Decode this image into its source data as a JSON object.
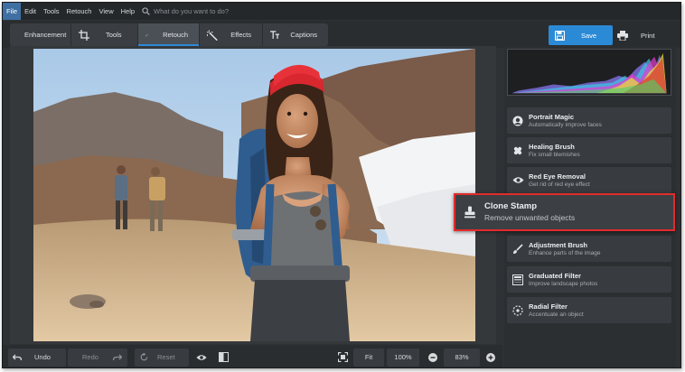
{
  "menu": {
    "items": [
      "File",
      "Edit",
      "Tools",
      "Retouch",
      "View",
      "Help"
    ],
    "search_placeholder": "What do you want to do?"
  },
  "tabs": [
    {
      "label": "Enhancement",
      "icon": "sliders-icon"
    },
    {
      "label": "Tools",
      "icon": "crop-icon"
    },
    {
      "label": "Retouch",
      "icon": "brush-icon",
      "active": true
    },
    {
      "label": "Effects",
      "icon": "magic-wand-icon"
    },
    {
      "label": "Captions",
      "icon": "text-icon"
    }
  ],
  "actions": {
    "save": "Save",
    "print": "Print"
  },
  "tools": [
    {
      "title": "Portrait Magic",
      "subtitle": "Automatically improve faces",
      "icon": "portrait-icon"
    },
    {
      "title": "Healing Brush",
      "subtitle": "Fix small blemishes",
      "icon": "bandage-icon"
    },
    {
      "title": "Red Eye Removal",
      "subtitle": "Get rid of red eye effect",
      "icon": "eye-icon"
    },
    {
      "title": "Clone Stamp",
      "subtitle": "Remove unwanted objects",
      "icon": "stamp-icon",
      "highlighted": true
    },
    {
      "title": "Adjustment Brush",
      "subtitle": "Enhance parts of the image",
      "icon": "brush-icon"
    },
    {
      "title": "Graduated Filter",
      "subtitle": "Improve landscape photos",
      "icon": "gradient-icon"
    },
    {
      "title": "Radial Filter",
      "subtitle": "Accentuate an object",
      "icon": "radial-icon"
    }
  ],
  "bottom": {
    "undo": "Undo",
    "redo": "Redo",
    "reset": "Reset",
    "fit": "Fit",
    "zoom_100": "100%",
    "zoom_value": "83%"
  },
  "colors": {
    "accent": "#2b8ad6",
    "highlight_border": "#e22b2b",
    "background": "#2f3235"
  }
}
